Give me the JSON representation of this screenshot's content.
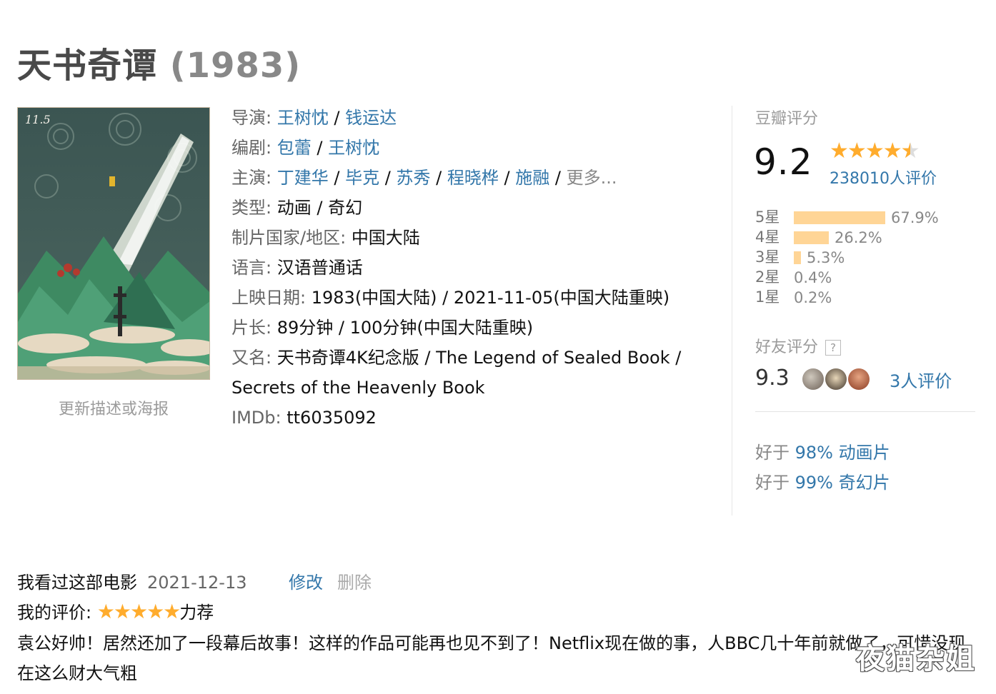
{
  "movie": {
    "title": "天书奇谭",
    "year": "(1983)"
  },
  "poster": {
    "date_text": "11.5",
    "update_link": "更新描述或海报"
  },
  "info": {
    "director_label": "导演:",
    "directors": [
      "王树忱",
      "钱运达"
    ],
    "writer_label": "编剧:",
    "writers": [
      "包蕾",
      "王树忱"
    ],
    "cast_label": "主演:",
    "cast": [
      "丁建华",
      "毕克",
      "苏秀",
      "程晓桦",
      "施融"
    ],
    "cast_more": "更多...",
    "genre_label": "类型:",
    "genre_value": "动画 / 奇幻",
    "country_label": "制片国家/地区:",
    "country_value": "中国大陆",
    "language_label": "语言:",
    "language_value": "汉语普通话",
    "release_label": "上映日期:",
    "release_value": "1983(中国大陆) / 2021-11-05(中国大陆重映)",
    "runtime_label": "片长:",
    "runtime_value": "89分钟 / 100分钟(中国大陆重映)",
    "aka_label": "又名:",
    "aka_value": "天书奇谭4K纪念版 / The Legend of Sealed Book / Secrets of the Heavenly Book",
    "imdb_label": "IMDb:",
    "imdb_value": "tt6035092"
  },
  "rating": {
    "title": "豆瓣评分",
    "score": "9.2",
    "stars": 4.5,
    "count_text": "238010人评价",
    "distribution": [
      {
        "label": "5星",
        "percent": 67.9,
        "text": "67.9%"
      },
      {
        "label": "4星",
        "percent": 26.2,
        "text": "26.2%"
      },
      {
        "label": "3星",
        "percent": 5.3,
        "text": "5.3%"
      },
      {
        "label": "2星",
        "percent": 0.4,
        "text": "0.4%"
      },
      {
        "label": "1星",
        "percent": 0.2,
        "text": "0.2%"
      }
    ],
    "friend_title": "好友评分",
    "friend_help": "?",
    "friend_score": "9.3",
    "friend_count_text": "3人评价",
    "better_than": [
      {
        "prefix": "好于",
        "percent": "98%",
        "genre": "动画片"
      },
      {
        "prefix": "好于",
        "percent": "99%",
        "genre": "奇幻片"
      }
    ]
  },
  "my": {
    "status": "我看过这部电影",
    "date": "2021-12-13",
    "edit": "修改",
    "delete": "删除",
    "rating_label": "我的评价:",
    "rating_stars": 5,
    "rating_text": "力荐",
    "comment": "袁公好帅！居然还加了一段幕后故事！这样的作品可能再也见不到了！Netflix现在做的事，人BBC几十年前就做了，可惜没现在这么财大气粗"
  },
  "watermark": "夜猫杂姐",
  "colors": {
    "link": "#3377aa",
    "star": "#ffac2d",
    "bar": "#ffd596"
  }
}
